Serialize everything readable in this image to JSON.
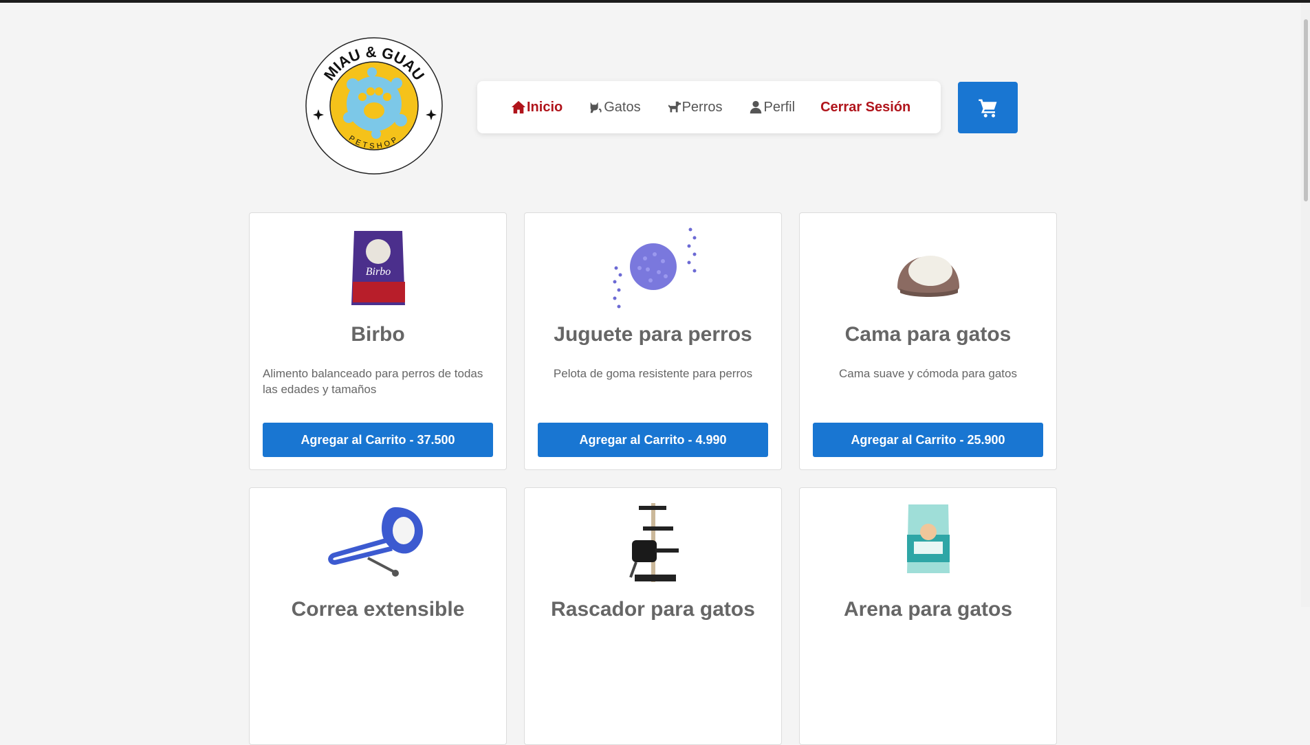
{
  "brand": {
    "logo_top_text": "MIAU & GUAU",
    "logo_bottom_text": "PETSHOP"
  },
  "nav": {
    "items": [
      {
        "label": "Inicio",
        "icon": "home-icon"
      },
      {
        "label": "Gatos",
        "icon": "cat-icon"
      },
      {
        "label": "Perros",
        "icon": "dog-icon"
      },
      {
        "label": "Perfil",
        "icon": "user-icon"
      }
    ],
    "logout_label": "Cerrar Sesión",
    "cart_icon": "cart-icon"
  },
  "colors": {
    "accent": "#1976d2",
    "danger": "#b0141b"
  },
  "products": [
    {
      "name": "Birbo",
      "description": "Alimento balanceado para perros de todas las edades y tamaños",
      "button": "Agregar al Carrito - 37.500"
    },
    {
      "name": "Juguete para perros",
      "description": "Pelota de goma resistente para perros",
      "button": "Agregar al Carrito - 4.990"
    },
    {
      "name": "Cama para gatos",
      "description": "Cama suave y cómoda para gatos",
      "button": "Agregar al Carrito - 25.900"
    },
    {
      "name": "Correa extensible"
    },
    {
      "name": "Rascador para gatos"
    },
    {
      "name": "Arena para gatos"
    }
  ]
}
